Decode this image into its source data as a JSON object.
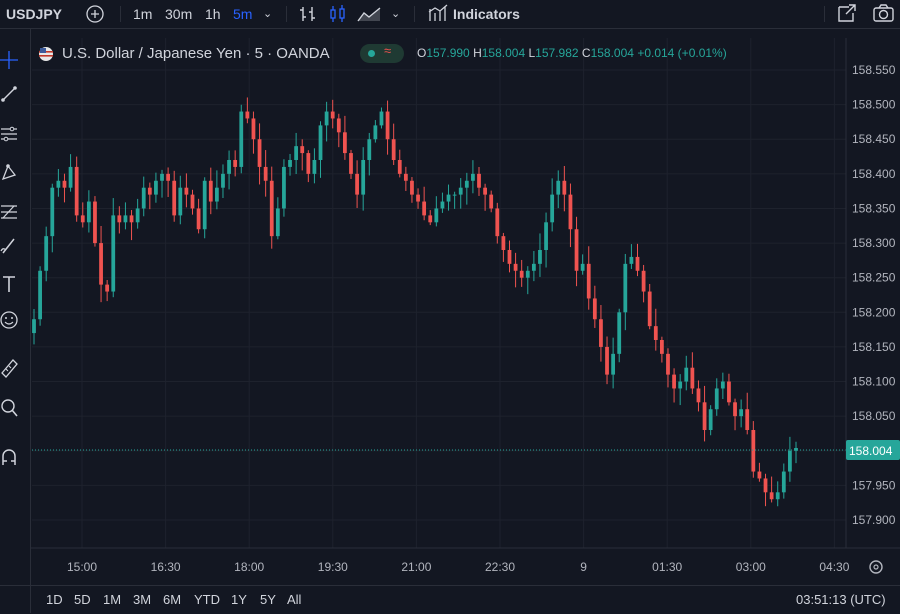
{
  "toolbar": {
    "symbol": "USDJPY",
    "intervals": [
      "1m",
      "30m",
      "1h",
      "5m"
    ],
    "active_interval": "5m",
    "indicators_label": "Indicators"
  },
  "legend": {
    "title": "U.S. Dollar / Japanese Yen · 5 · OANDA",
    "o_label": "O",
    "o_value": "157.990",
    "h_label": "H",
    "h_value": "158.004",
    "l_label": "L",
    "l_value": "157.982",
    "c_label": "C",
    "c_value": "158.004",
    "change": "+0.014 (+0.01%)"
  },
  "colors": {
    "up": "#26a69a",
    "down": "#ef5350",
    "price_tag": "#26a69a",
    "background": "#131722",
    "grid": "#1e222d"
  },
  "chart_data": {
    "type": "candlestick",
    "ylim": [
      157.87,
      158.575
    ],
    "y_ticks": [
      "158.550",
      "158.500",
      "158.450",
      "158.400",
      "158.350",
      "158.300",
      "158.250",
      "158.200",
      "158.150",
      "158.100",
      "158.050",
      "158.000",
      "157.950",
      "157.900"
    ],
    "x_ticks": [
      "15:00",
      "16:30",
      "18:00",
      "19:30",
      "21:00",
      "22:30",
      "9",
      "01:30",
      "03:00",
      "04:30"
    ],
    "last_price": "158.004",
    "grid": true,
    "close_series": [
      158.19,
      158.26,
      158.31,
      158.38,
      158.39,
      158.38,
      158.41,
      158.34,
      158.33,
      158.36,
      158.3,
      158.24,
      158.23,
      158.34,
      158.33,
      158.34,
      158.33,
      158.35,
      158.38,
      158.37,
      158.39,
      158.4,
      158.39,
      158.34,
      158.38,
      158.37,
      158.35,
      158.32,
      158.39,
      158.36,
      158.38,
      158.4,
      158.42,
      158.41,
      158.49,
      158.48,
      158.45,
      158.41,
      158.39,
      158.31,
      158.35,
      158.41,
      158.42,
      158.44,
      158.43,
      158.4,
      158.42,
      158.47,
      158.49,
      158.48,
      158.46,
      158.43,
      158.4,
      158.37,
      158.42,
      158.45,
      158.47,
      158.49,
      158.45,
      158.42,
      158.4,
      158.39,
      158.37,
      158.36,
      158.34,
      158.33,
      158.35,
      158.36,
      158.37,
      158.37,
      158.38,
      158.39,
      158.4,
      158.38,
      158.37,
      158.35,
      158.31,
      158.29,
      158.27,
      158.26,
      158.25,
      158.26,
      158.27,
      158.29,
      158.33,
      158.37,
      158.39,
      158.37,
      158.32,
      158.26,
      158.27,
      158.22,
      158.19,
      158.15,
      158.11,
      158.14,
      158.2,
      158.27,
      158.28,
      158.26,
      158.23,
      158.18,
      158.16,
      158.14,
      158.11,
      158.09,
      158.1,
      158.12,
      158.09,
      158.07,
      158.03,
      158.06,
      158.09,
      158.1,
      158.07,
      158.05,
      158.06,
      158.03,
      157.97,
      157.96,
      157.94,
      157.93,
      157.94,
      157.97,
      158.0,
      158.004
    ]
  },
  "bottombar": {
    "ranges": [
      "1D",
      "5D",
      "1M",
      "3M",
      "6M",
      "YTD",
      "1Y",
      "5Y",
      "All"
    ],
    "clock": "03:51:13 (UTC)"
  }
}
